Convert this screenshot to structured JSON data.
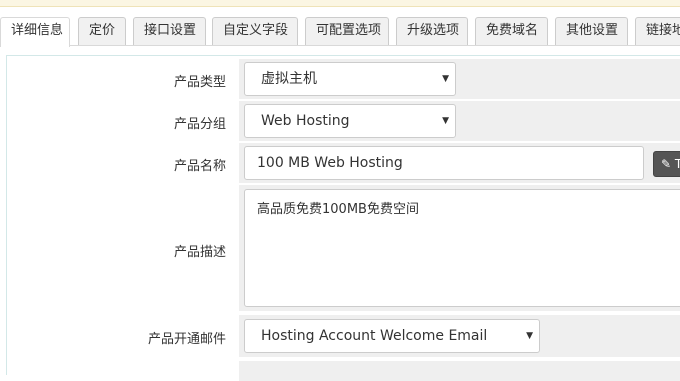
{
  "tabs": [
    {
      "label": "详细信息",
      "active": true
    },
    {
      "label": "定价"
    },
    {
      "label": "接口设置"
    },
    {
      "label": "自定义字段"
    },
    {
      "label": "可配置选项"
    },
    {
      "label": "升级选项"
    },
    {
      "label": "免费域名"
    },
    {
      "label": "其他设置"
    },
    {
      "label": "链接地址"
    }
  ],
  "form": {
    "product_type": {
      "label": "产品类型",
      "value": "虚拟主机"
    },
    "product_group": {
      "label": "产品分组",
      "value": "Web Hosting"
    },
    "product_name": {
      "label": "产品名称",
      "value": "100 MB Web Hosting",
      "button_label": "Tr"
    },
    "product_desc": {
      "label": "产品描述",
      "value": "高品质免费100MB免费空间"
    },
    "welcome_email": {
      "label": "产品开通邮件",
      "value": "Hosting Account Welcome Email"
    }
  },
  "icons": {
    "caret": "caret-down-icon",
    "edit": "edit-icon"
  },
  "colors": {
    "panel_border": "#d3e8e8",
    "field_bg": "#efefef",
    "top_strip": "#fbf6e3"
  }
}
